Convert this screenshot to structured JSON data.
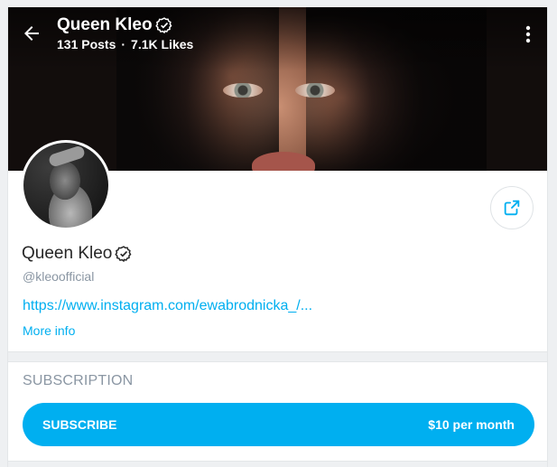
{
  "header": {
    "title": "Queen Kleo",
    "posts": "131 Posts",
    "separator": "·",
    "likes": "7.1K Likes"
  },
  "profile": {
    "name": "Queen Kleo",
    "handle": "@kleoofficial",
    "link": "https://www.instagram.com/ewabrodnicka_/...",
    "more_info": "More info"
  },
  "subscription": {
    "label": "SUBSCRIPTION",
    "button_label": "SUBSCRIBE",
    "price": "$10 per month"
  },
  "icons": {
    "back": "arrow-left-icon",
    "verified": "verified-badge-icon",
    "more": "more-vertical-icon",
    "share": "share-icon"
  },
  "colors": {
    "accent": "#00aff0",
    "muted": "#8a96a3",
    "text": "#262626"
  }
}
